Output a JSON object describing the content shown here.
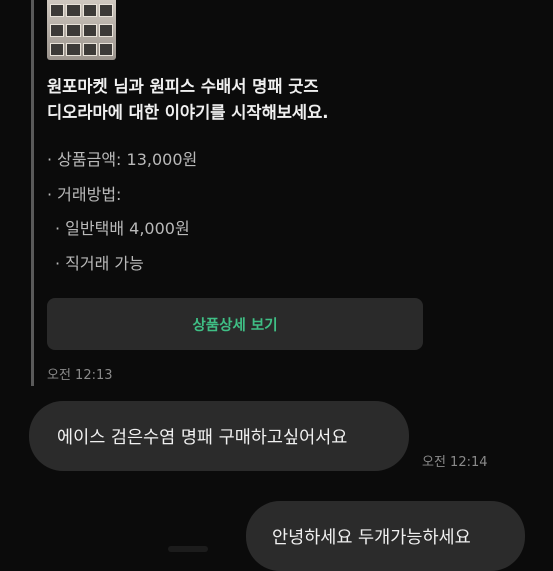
{
  "product_card": {
    "title_line1": "원포마켓 님과 원피스 수배서 명패 굿즈",
    "title_line2": "디오라마에 대한 이야기를 시작해보세요.",
    "price_text": "· 상품금액: 13,000원",
    "method_label": "· 거래방법:",
    "shipping_option": "· 일반택배 4,000원",
    "direct_option": "· 직거래 가능",
    "detail_button_label": "상품상세 보기",
    "timestamp": "오전 12:13"
  },
  "messages": [
    {
      "text": "에이스 검은수염 명패 구매하고싶어서요",
      "timestamp": "오전 12:14"
    },
    {
      "text": "안녕하세요 두개가능하세요"
    }
  ],
  "colors": {
    "background": "#0b0b0b",
    "bubble": "#2b2b2b",
    "accent_green": "#3fbf85",
    "secondary_text": "#b9b9b9",
    "timestamp_text": "#8a8a8a"
  }
}
